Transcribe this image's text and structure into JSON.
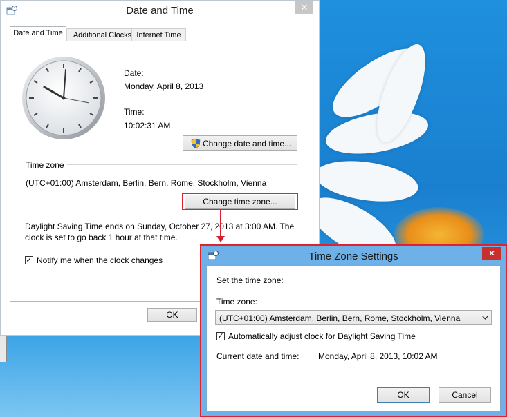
{
  "main_dialog": {
    "title": "Date and Time",
    "close_glyph": "✕",
    "tabs": [
      {
        "label": "Date and Time",
        "active": true
      },
      {
        "label": "Additional Clocks",
        "active": false
      },
      {
        "label": "Internet Time",
        "active": false
      }
    ],
    "date_label": "Date:",
    "date_value": "Monday, April 8, 2013",
    "time_label": "Time:",
    "time_value": "10:02:31 AM",
    "change_datetime_button": "Change date and time...",
    "timezone_section_label": "Time zone",
    "timezone_value": "(UTC+01:00) Amsterdam, Berlin, Bern, Rome, Stockholm, Vienna",
    "change_timezone_button": "Change time zone...",
    "dst_text_line1": "Daylight Saving Time ends on Sunday, October 27, 2013 at 3:00 AM. The",
    "dst_text_line2": "clock is set to go back 1 hour at that time.",
    "notify_checkbox_label": "Notify me when the clock changes",
    "notify_checked": true,
    "ok_button": "OK"
  },
  "tz_dialog": {
    "title": "Time Zone Settings",
    "close_glyph": "✕",
    "set_label": "Set the time zone:",
    "timezone_label": "Time zone:",
    "timezone_selected": "(UTC+01:00) Amsterdam, Berlin, Bern, Rome, Stockholm, Vienna",
    "auto_dst_label": "Automatically adjust clock for Daylight Saving Time",
    "auto_dst_checked": true,
    "current_label": "Current date and time:",
    "current_value": "Monday, April 8, 2013, 10:02 AM",
    "ok_button": "OK",
    "cancel_button": "Cancel"
  },
  "colors": {
    "highlight": "#e0212f",
    "desktop": "#1c8fd6",
    "tz_frame": "#6eb0e8"
  },
  "icons": {
    "clock": "analog-clock-icon",
    "shield": "uac-shield-icon",
    "app": "date-time-app-icon",
    "dropdown": "chevron-down-icon"
  }
}
